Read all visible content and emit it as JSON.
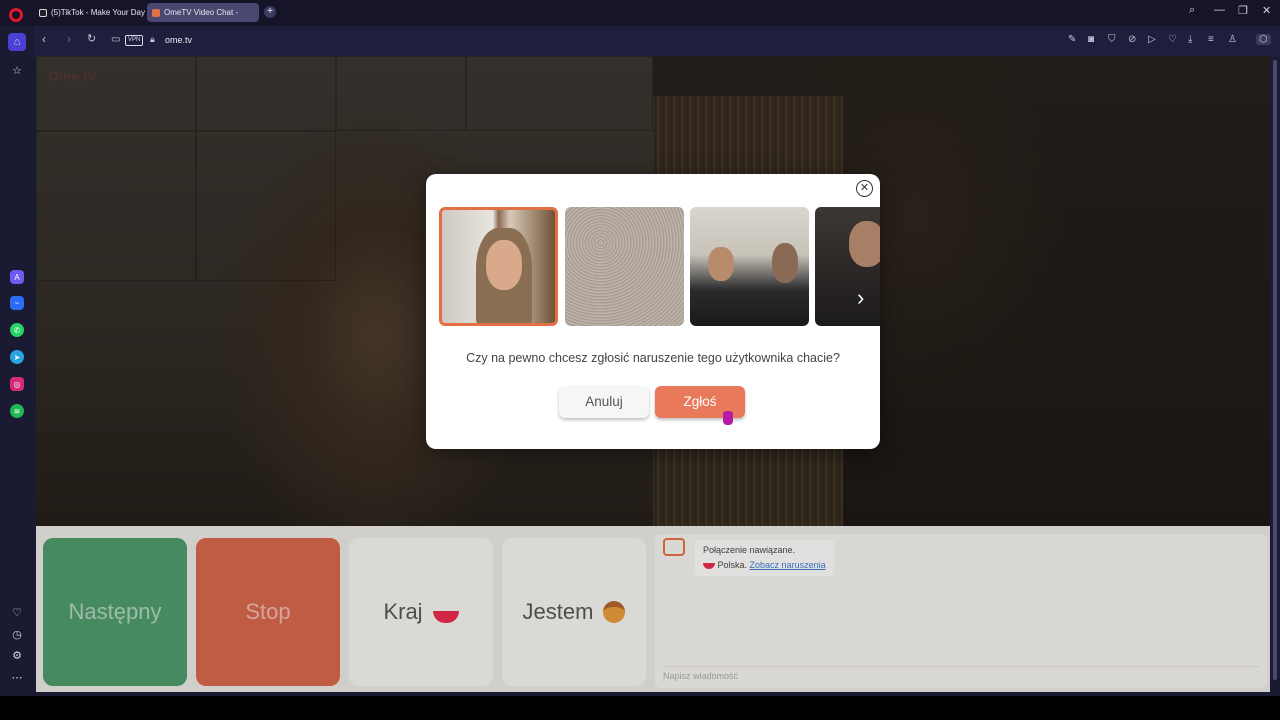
{
  "browser": {
    "tabs": [
      {
        "label": "(5)TikTok - Make Your Day",
        "active": false,
        "icon": "tiktok-icon"
      },
      {
        "label": "OmeTV Video Chat -",
        "active": true,
        "icon": "ometv-icon"
      }
    ],
    "url": "ome.tv",
    "vpn_label": "VPN"
  },
  "sidebar": {
    "icons": [
      "opera-logo-icon",
      "home-icon",
      "star-icon",
      "aria-icon",
      "messenger-icon",
      "whatsapp-icon",
      "telegram-icon",
      "instagram-icon",
      "spotify-icon",
      "heart-icon",
      "history-icon",
      "settings-icon",
      "more-icon"
    ]
  },
  "modal": {
    "question": "Czy na pewno chcesz zgłosić naruszenie tego użytkownika chacie?",
    "cancel_label": "Anuluj",
    "report_label": "Zgłoś",
    "accent_color": "#e8795a"
  },
  "controls": {
    "next_label": "Następny",
    "stop_label": "Stop",
    "country_label": "Kraj",
    "iam_label": "Jestem"
  },
  "chat": {
    "status_line": "Połączenie nawiązane.",
    "country_name": "Polska.",
    "link_text": "Zobacz naruszenia",
    "input_placeholder": "Napisz wiadomość"
  },
  "watermark": "Ome.tv"
}
